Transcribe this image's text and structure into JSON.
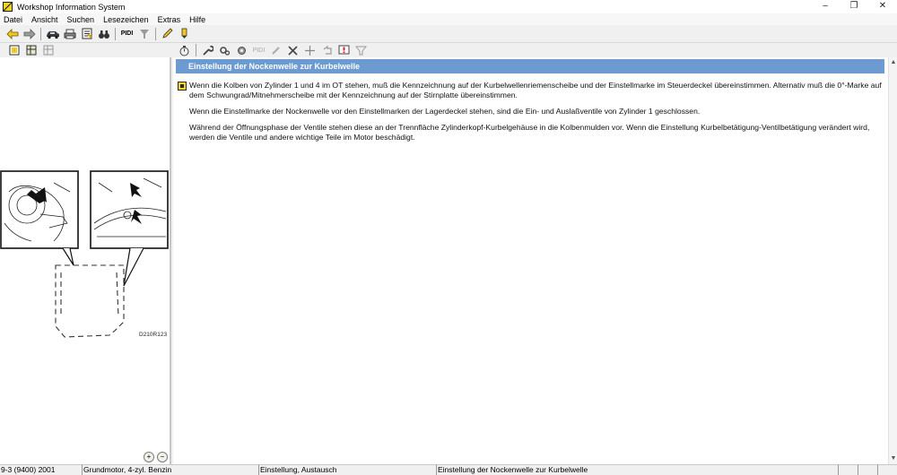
{
  "window": {
    "title": "Workshop Information System",
    "controls": [
      "–",
      "❐",
      "✕"
    ]
  },
  "menu": [
    "Datei",
    "Ansicht",
    "Suchen",
    "Lesezeichen",
    "Extras",
    "Hilfe"
  ],
  "toolbar1": [
    "back-arrow-icon",
    "forward-arrow-icon",
    "car-icon",
    "print-icon",
    "document-icon",
    "binoculars-icon",
    "PIDI",
    "funnel-icon",
    "pencil-icon",
    "highlighter-icon"
  ],
  "toolbar1_labels": {
    "pidi": "PIDI"
  },
  "toolbar2_right_labels": {
    "pidi": "PIDI"
  },
  "illustration": {
    "code": "D210R123"
  },
  "article": {
    "title": "Einstellung der Nockenwelle zur Kurbelwelle",
    "paragraphs": [
      "Wenn die Kolben von Zylinder 1 und 4 im OT stehen, muß die Kennzeichnung auf der Kurbelwellenriemenscheibe und der Einstellmarke im Steuerdeckel übereinstimmen. Alternativ muß die 0°-Marke auf dem Schwungrad/Mitnehmerscheibe mit der Kennzeichnung auf der Stirnplatte übereinstimmen.",
      "Wenn die Einstellmarke der Nockenwelle vor den Einstellmarken der Lagerdeckel stehen, sind die Ein- und Auslaßventile von Zylinder 1 geschlossen.",
      "Während der Öffnungsphase der Ventile stehen diese an der Trennfläche Zylinderkopf-Kurbelgehäuse in die Kolbenmulden vor. Wenn die Einstellung Kurbelbetätigung-Ventilbetätigung verändert wird, werden die Ventile und andere wichtige Teile im Motor beschädigt."
    ]
  },
  "status": {
    "vehicle": "9-3 (9400) 2001",
    "engine": "Grundmotor, 4-zyl. Benzin",
    "section": "Einstellung, Austausch",
    "topic": "Einstellung der Nockenwelle zur Kurbelwelle"
  },
  "zoom": {
    "in": "+",
    "out": "−"
  }
}
